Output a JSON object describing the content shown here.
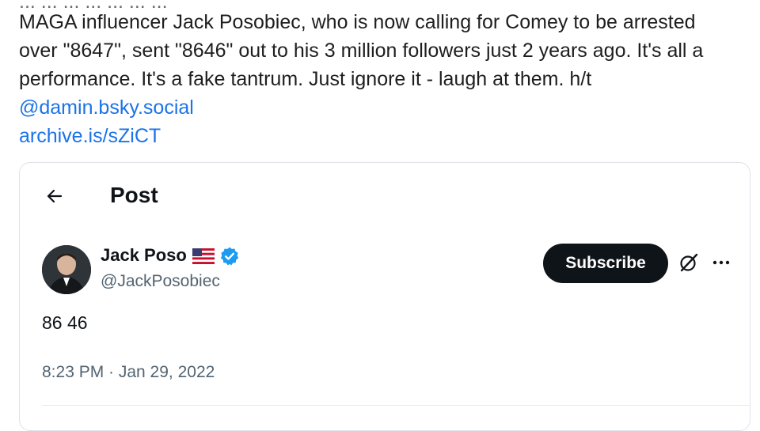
{
  "post": {
    "cut_line": "... ... ... ... ... ... ...",
    "text": "MAGA influencer Jack Posobiec, who is now calling for Comey to be arrested over \"8647\", sent \"8646\" out to his 3 million followers just 2 years ago.  It's all a performance. It's a fake tantrum. Just ignore it - laugh at them.   h/t ",
    "mention": "@damin.bsky.social",
    "link": "archive.is/sZiCT"
  },
  "embed": {
    "page_title": "Post",
    "author": {
      "name": "Jack Poso",
      "handle": "@JackPosobiec",
      "verified_color": "#1d9bf0"
    },
    "subscribe_label": "Subscribe",
    "tweet_text": "86 46",
    "timestamp": "8:23 PM · Jan 29, 2022",
    "icons": [
      "back-arrow-icon",
      "us-flag-icon",
      "verified-badge-icon",
      "grok-icon",
      "more-icon"
    ]
  },
  "colors": {
    "link": "#1a73e8",
    "button_bg": "#0f1419",
    "muted": "#536471"
  }
}
